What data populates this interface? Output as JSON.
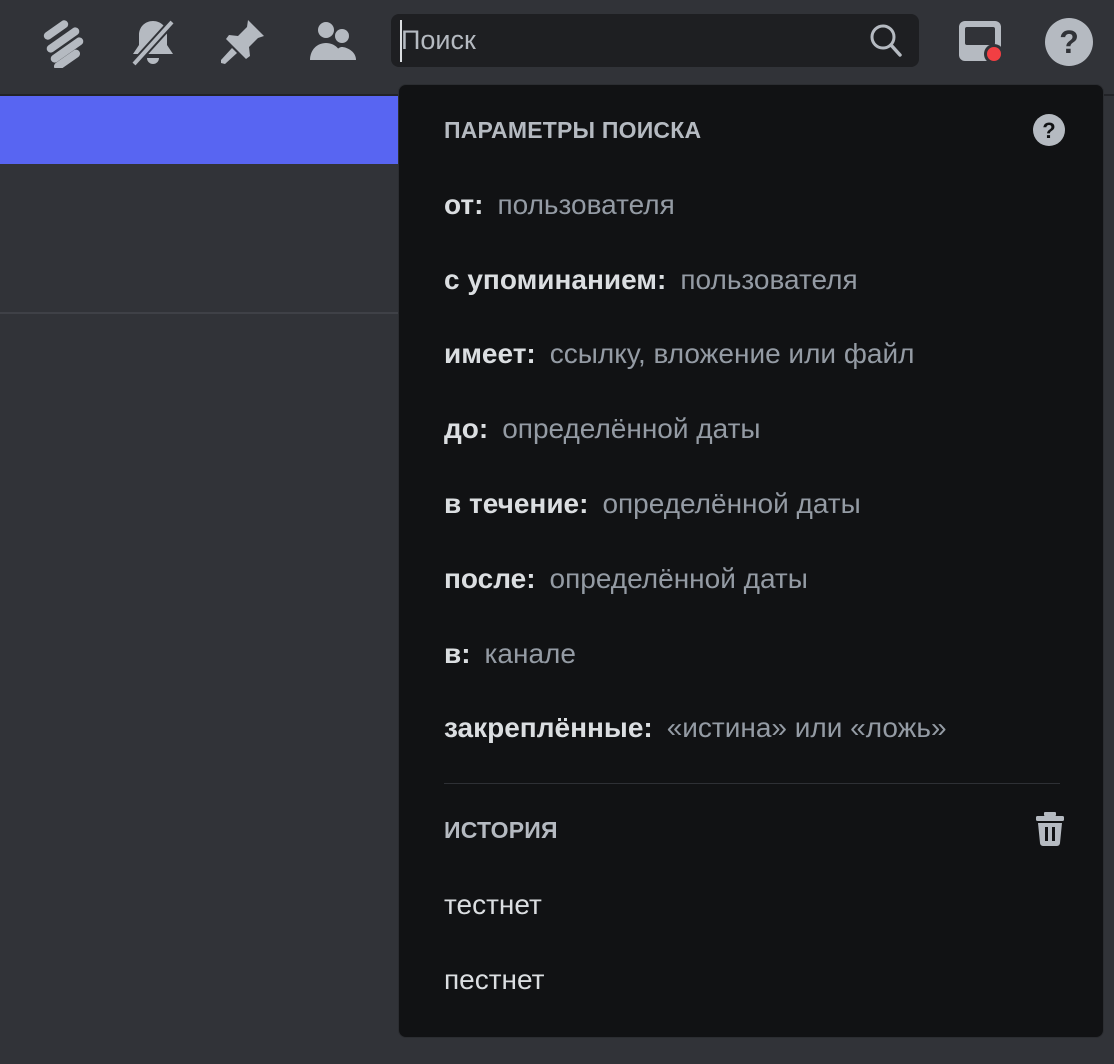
{
  "toolbar": {
    "icons": [
      "threads-icon",
      "mute-notifications-icon",
      "pin-icon",
      "member-list-icon",
      "inbox-icon",
      "help-icon"
    ],
    "inbox_badge_color": "#f23f43"
  },
  "search": {
    "placeholder": "Поиск",
    "value": ""
  },
  "search_options": {
    "title": "ПАРАМЕТРЫ ПОИСКА",
    "items": [
      {
        "key": "от:",
        "value": "пользователя"
      },
      {
        "key": "с упоминанием:",
        "value": "пользователя"
      },
      {
        "key": "имеет:",
        "value": "ссылку, вложение или файл"
      },
      {
        "key": "до:",
        "value": "определённой даты"
      },
      {
        "key": "в течение:",
        "value": "определённой даты"
      },
      {
        "key": "после:",
        "value": "определённой даты"
      },
      {
        "key": "в:",
        "value": "канале"
      },
      {
        "key": "закреплённые:",
        "value": "«истина» или «ложь»"
      }
    ]
  },
  "history": {
    "title": "ИСТОРИЯ",
    "items": [
      "тестнет",
      "пестнет"
    ]
  },
  "colors": {
    "accent": "#5865f2",
    "background": "#313338",
    "popout": "#111214"
  }
}
